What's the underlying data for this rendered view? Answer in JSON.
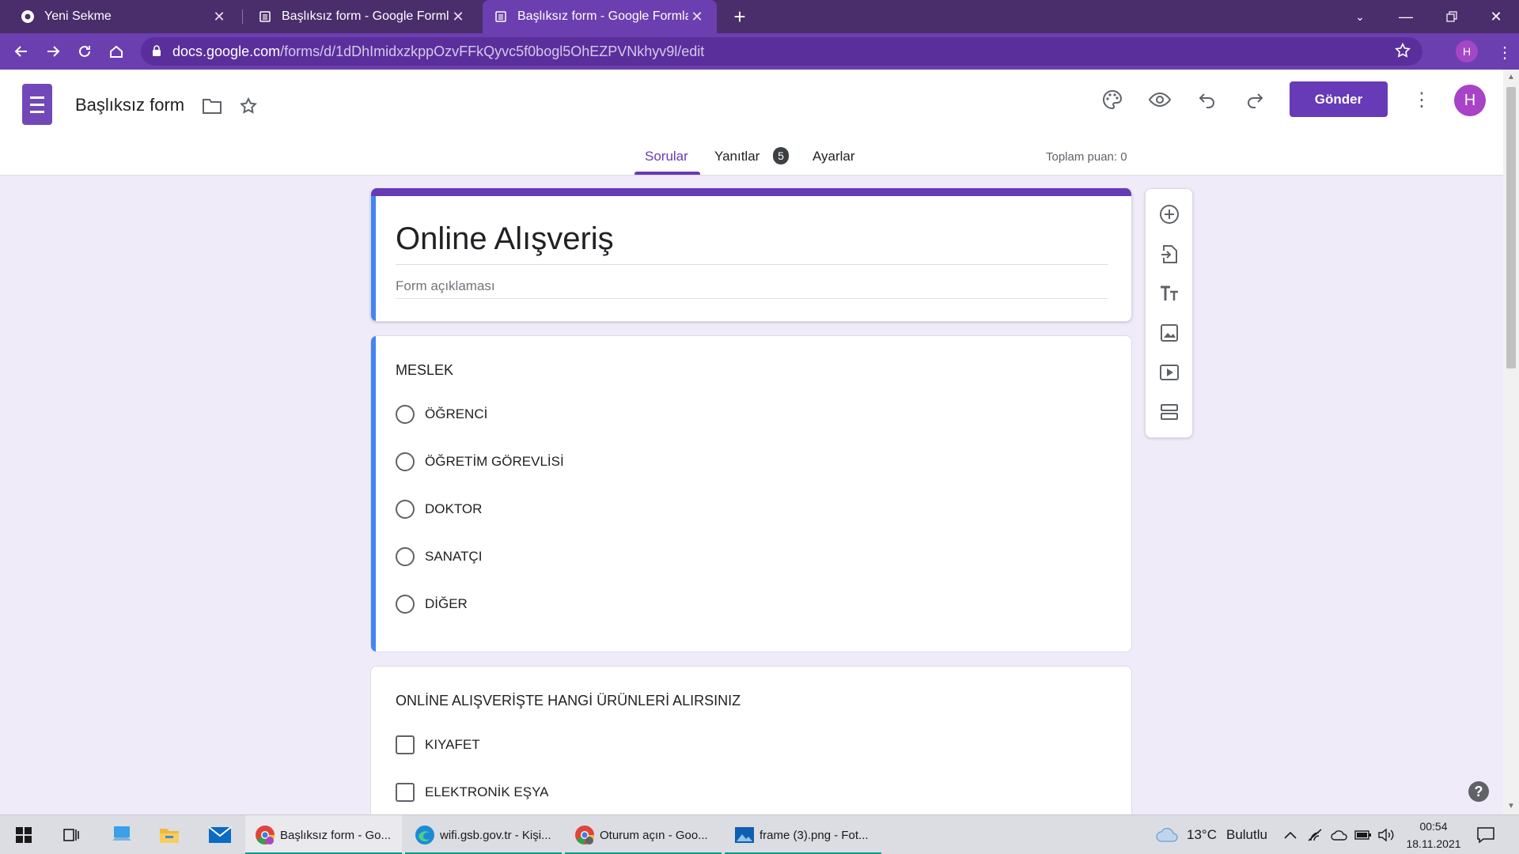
{
  "browser": {
    "tabs": [
      {
        "title": "Yeni Sekme",
        "active": false
      },
      {
        "title": "Başlıksız form - Google Formlar",
        "active": false
      },
      {
        "title": "Başlıksız form - Google Formlar",
        "active": true
      }
    ],
    "url_host": "docs.google.com",
    "url_path": "/forms/d/1dDhImidxzkppOzvFFkQyvc5f0bogl5OhEZPVNkhyv9l/edit",
    "profile_initial": "H"
  },
  "header": {
    "doc_title": "Başlıksız form",
    "send_label": "Gönder",
    "avatar_initial": "H",
    "tabs": {
      "questions": "Sorular",
      "responses": "Yanıtlar",
      "responses_count": "5",
      "settings": "Ayarlar"
    },
    "total_points": "Toplam puan: 0"
  },
  "form": {
    "title": "Online Alışveriş",
    "description_placeholder": "Form açıklaması",
    "questions": [
      {
        "title": "MESLEK",
        "type": "radio",
        "options": [
          "ÖĞRENCİ",
          "ÖĞRETİM GÖREVLİSİ",
          "DOKTOR",
          "SANATÇI",
          "DİĞER"
        ]
      },
      {
        "title": "ONLİNE ALIŞVERİŞTE HANGİ ÜRÜNLERİ ALIRSINIZ",
        "type": "checkbox",
        "options": [
          "KIYAFET",
          "ELEKTRONİK EŞYA"
        ]
      }
    ]
  },
  "taskbar": {
    "apps": [
      {
        "label": "Başlıksız form - Go...",
        "active": true
      },
      {
        "label": "wifi.gsb.gov.tr - Kişi...",
        "active": false
      },
      {
        "label": "Oturum açın - Goo...",
        "active": false
      },
      {
        "label": "frame (3).png - Fot...",
        "active": false
      }
    ],
    "weather_temp": "13°C",
    "weather_desc": "Bulutlu",
    "time": "00:54",
    "date": "18.11.2021"
  },
  "colors": {
    "accent": "#673ab7",
    "tabstrip": "#4a2d6b",
    "toolbar": "#6c3fb0",
    "background": "#f0ebf8",
    "focus_bar": "#4285f4"
  }
}
